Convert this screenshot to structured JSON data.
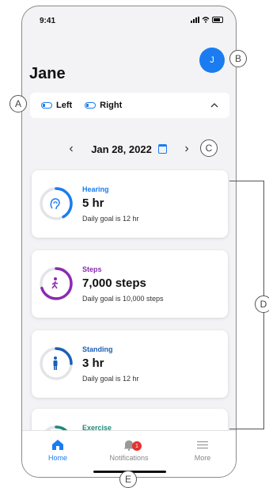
{
  "status_bar": {
    "time": "9:41"
  },
  "avatar": {
    "initial": "J",
    "color": "#1a7cf0"
  },
  "user": {
    "name": "Jane"
  },
  "ears": {
    "left_label": "Left",
    "right_label": "Right"
  },
  "date_nav": {
    "date": "Jan 28, 2022"
  },
  "cards": [
    {
      "category": "Hearing",
      "value": "5 hr",
      "goal": "Daily goal is 12 hr",
      "color": "#1a7cf0",
      "progress": 0.42,
      "icon": "ear-icon"
    },
    {
      "category": "Steps",
      "value": "7,000 steps",
      "goal": "Daily goal is 10,000 steps",
      "color": "#8a2bb0",
      "progress": 0.7,
      "icon": "walking-person-icon"
    },
    {
      "category": "Standing",
      "value": "3 hr",
      "goal": "Daily goal is 12 hr",
      "color": "#1a5fb4",
      "progress": 0.25,
      "icon": "standing-person-icon"
    },
    {
      "category": "Exercise",
      "color": "#1f8a7a",
      "progress": 0.3,
      "icon": "exercise-icon"
    }
  ],
  "tabs": [
    {
      "label": "Home",
      "icon": "home-icon",
      "active": true
    },
    {
      "label": "Notifications",
      "icon": "bell-icon",
      "badge": "1"
    },
    {
      "label": "More",
      "icon": "menu-icon"
    }
  ],
  "callouts": {
    "a": "A",
    "b": "B",
    "c": "C",
    "d": "D",
    "e": "E"
  },
  "colors": {
    "accent": "#1a7cf0",
    "badge": "#e3342f",
    "background": "#f3f3f5"
  }
}
